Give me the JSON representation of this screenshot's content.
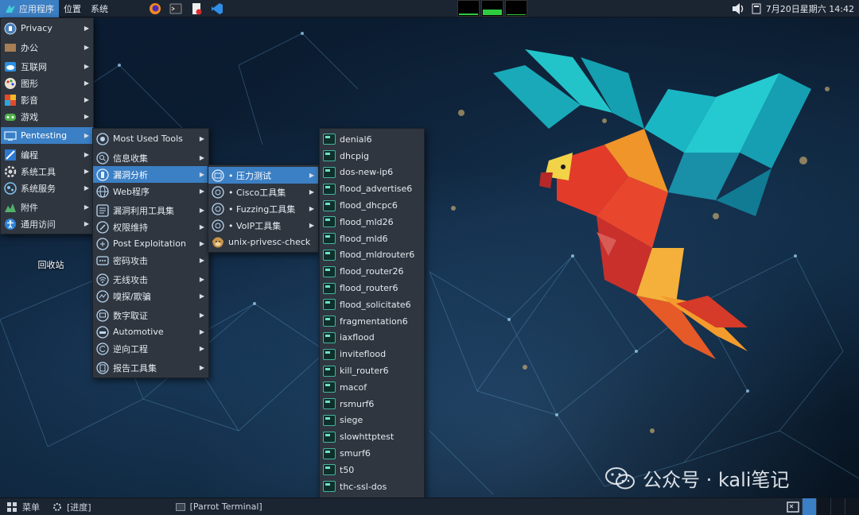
{
  "top_panel": {
    "menus": [
      "应用程序",
      "位置",
      "系统"
    ],
    "clock": "7月20日星期六 14:42"
  },
  "main_menu": {
    "items": [
      {
        "label": "Privacy",
        "icon": "privacy-icon",
        "submenu": true
      },
      {
        "label": "办公",
        "icon": "office-icon",
        "submenu": true
      },
      {
        "label": "互联网",
        "icon": "internet-icon",
        "submenu": true
      },
      {
        "label": "图形",
        "icon": "graphics-icon",
        "submenu": true
      },
      {
        "label": "影音",
        "icon": "multimedia-icon",
        "submenu": true
      },
      {
        "label": "游戏",
        "icon": "games-icon",
        "submenu": true
      },
      {
        "label": "Pentesting",
        "icon": "pentesting-icon",
        "submenu": true,
        "active": true
      },
      {
        "label": "编程",
        "icon": "programming-icon",
        "submenu": true
      },
      {
        "label": "系统工具",
        "icon": "system-tools-icon",
        "submenu": true
      },
      {
        "label": "系统服务",
        "icon": "system-services-icon",
        "submenu": true
      },
      {
        "label": "附件",
        "icon": "accessories-icon",
        "submenu": true
      },
      {
        "label": "通用访问",
        "icon": "accessibility-icon",
        "submenu": true
      }
    ]
  },
  "pentesting_menu": {
    "items": [
      {
        "label": "Most Used Tools"
      },
      {
        "label": "信息收集"
      },
      {
        "label": "漏洞分析",
        "active": true
      },
      {
        "label": "Web程序"
      },
      {
        "label": "漏洞利用工具集"
      },
      {
        "label": "权限维持"
      },
      {
        "label": "Post Exploitation"
      },
      {
        "label": "密码攻击"
      },
      {
        "label": "无线攻击"
      },
      {
        "label": "嗅探/欺骗"
      },
      {
        "label": "数字取证"
      },
      {
        "label": "Automotive"
      },
      {
        "label": "逆向工程"
      },
      {
        "label": "报告工具集"
      }
    ]
  },
  "vuln_menu": {
    "items": [
      {
        "label": "• 压力测试",
        "submenu": true,
        "active": true
      },
      {
        "label": "• Cisco工具集",
        "submenu": true
      },
      {
        "label": "• Fuzzing工具集",
        "submenu": true
      },
      {
        "label": "• VoIP工具集",
        "submenu": true
      },
      {
        "label": "unix-privesc-check",
        "submenu": false
      }
    ]
  },
  "stress_menu": {
    "items": [
      "denial6",
      "dhcpig",
      "dos-new-ip6",
      "flood_advertise6",
      "flood_dhcpc6",
      "flood_mld26",
      "flood_mld6",
      "flood_mldrouter6",
      "flood_router26",
      "flood_router6",
      "flood_solicitate6",
      "fragmentation6",
      "iaxflood",
      "inviteflood",
      "kill_router6",
      "macof",
      "rsmurf6",
      "siege",
      "slowhttptest",
      "smurf6",
      "t50",
      "thc-ssl-dos"
    ]
  },
  "desktop": {
    "trash_label": "回收站",
    "watermark": "公众号 · kali笔记"
  },
  "bottom_panel": {
    "menu_label": "菜单",
    "progress_label": "[进度]",
    "terminal_task": "[Parrot Terminal]"
  },
  "colors": {
    "highlight": "#3b7fc4",
    "menu_bg": "#2f3640",
    "panel_bg": "#1b2532"
  }
}
